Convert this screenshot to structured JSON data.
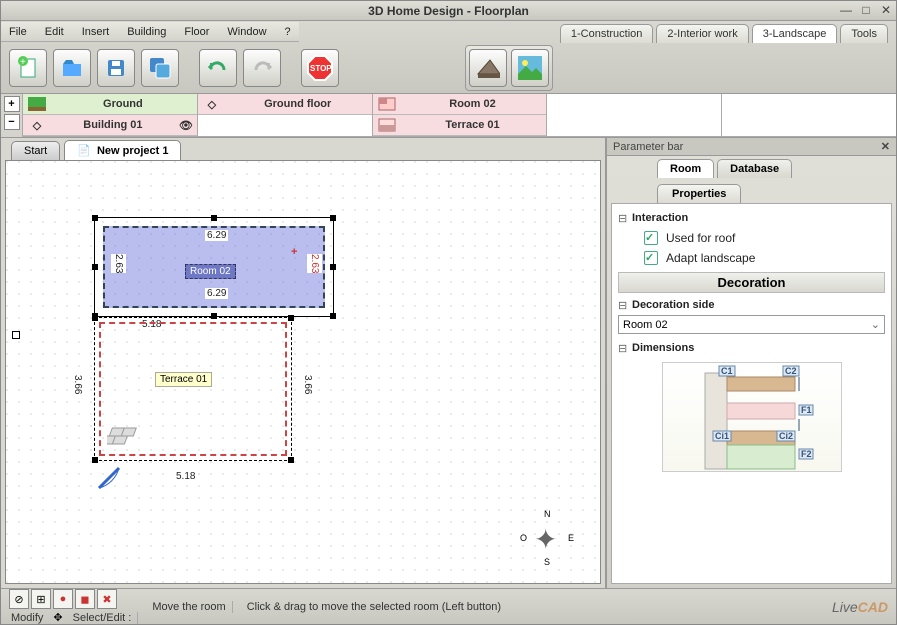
{
  "window": {
    "title": "3D Home Design - Floorplan"
  },
  "menu": [
    "File",
    "Edit",
    "Insert",
    "Building",
    "Floor",
    "Window",
    "?"
  ],
  "phase_tabs": [
    {
      "label": "1-Construction",
      "active": false
    },
    {
      "label": "2-Interior work",
      "active": false
    },
    {
      "label": "3-Landscape",
      "active": true
    },
    {
      "label": "Tools",
      "active": false
    }
  ],
  "floor_columns": [
    {
      "header": "Ground",
      "header_style": "green",
      "rows": [
        {
          "label": "Building 01",
          "visible": true
        }
      ]
    },
    {
      "header": "Ground floor",
      "rows": []
    },
    {
      "header": "Room 02",
      "rows": [
        {
          "label": "Terrace 01"
        }
      ]
    }
  ],
  "doc_tabs": [
    {
      "label": "Start",
      "active": false
    },
    {
      "label": "New project 1",
      "active": true
    }
  ],
  "canvas": {
    "room02": {
      "label": "Room 02",
      "dims": {
        "top": "6.29",
        "bottom": "6.29",
        "left": "2.63",
        "right": "2.63",
        "below": "5.18"
      }
    },
    "terrace": {
      "label": "Terrace 01",
      "dims": {
        "left": "3.66",
        "right": "3.66",
        "bottom": "5.18"
      }
    },
    "compass": {
      "n": "N",
      "s": "S",
      "e": "E",
      "o": "O"
    }
  },
  "parameter_bar": {
    "title": "Parameter bar",
    "tabs": [
      {
        "label": "Room",
        "active": true
      },
      {
        "label": "Database",
        "active": false
      }
    ],
    "subtab": "Properties",
    "interaction": {
      "header": "Interaction",
      "used_for_roof": "Used for roof",
      "adapt_landscape": "Adapt landscape"
    },
    "decoration": {
      "header": "Decoration",
      "side_header": "Decoration side",
      "side_value": "Room 02"
    },
    "dimensions": {
      "header": "Dimensions",
      "labels": {
        "c1": "C1",
        "c2": "C2",
        "f1": "F1",
        "ci1": "Ci1",
        "ci2": "Ci2",
        "f2": "F2"
      }
    }
  },
  "status": {
    "modify": "Modify",
    "select": "Select/Edit :",
    "move": "Move the room",
    "hint": "Click & drag to move the selected room (Left button)",
    "logo": "LiveCAD"
  }
}
